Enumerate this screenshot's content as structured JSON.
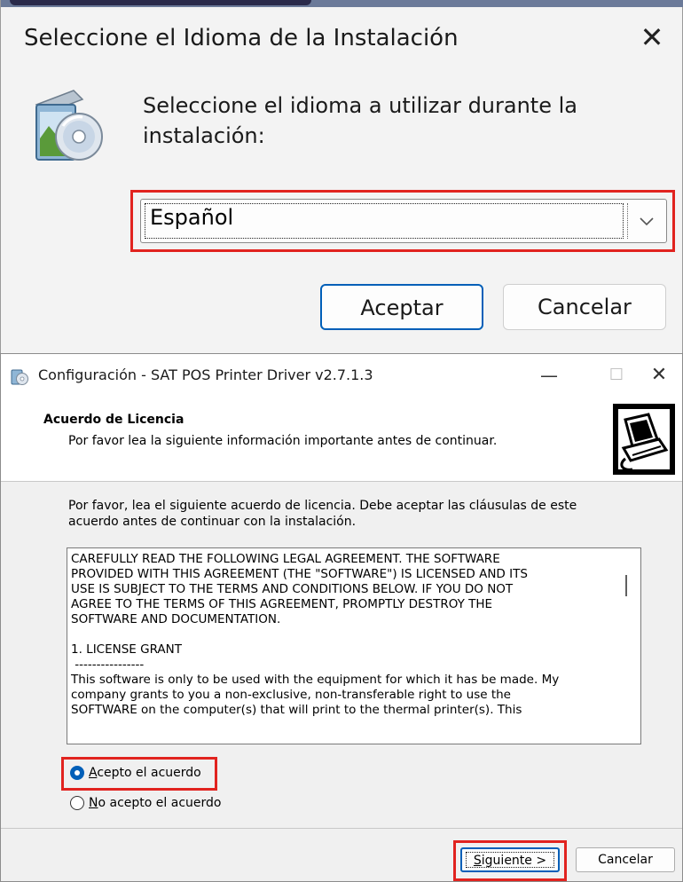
{
  "language_dialog": {
    "title": "Seleccione el Idioma de la Instalación",
    "close_glyph": "✕",
    "prompt": "Seleccione el idioma a utilizar durante la instalación:",
    "language_select": {
      "value": "Español",
      "icon": "chevron-down-icon"
    },
    "buttons": {
      "accept": "Aceptar",
      "cancel": "Cancelar"
    },
    "icon": "setup-cd-icon",
    "highlight_color": "#e1231f",
    "accent_color": "#005fb8"
  },
  "setup_wizard": {
    "window_title": "Configuración - SAT POS Printer Driver v2.7.1.3",
    "caption_buttons": {
      "minimize": "—",
      "maximize": "☐",
      "close": "✕"
    },
    "header": {
      "title": "Acuerdo de Licencia",
      "subtitle": "Por favor lea la siguiente información importante antes de continuar.",
      "icon": "computer-icon"
    },
    "intro": "Por favor, lea el siguiente acuerdo de licencia. Debe aceptar las cláusulas de este acuerdo antes de continuar con la instalación.",
    "license_text": "CAREFULLY READ THE FOLLOWING LEGAL AGREEMENT. THE SOFTWARE\nPROVIDED WITH THIS AGREEMENT (THE \"SOFTWARE\") IS LICENSED AND ITS\nUSE IS SUBJECT TO THE TERMS AND CONDITIONS BELOW. IF YOU DO NOT\nAGREE TO THE TERMS OF THIS AGREEMENT, PROMPTLY DESTROY THE\nSOFTWARE AND DOCUMENTATION.\n\n1. LICENSE GRANT\n ----------------\nThis software is only to be used with the equipment for which it has be made. My\ncompany grants to you a non-exclusive, non-transferable right to use the\nSOFTWARE on the computer(s) that will print to the thermal printer(s). This",
    "radio_accept": {
      "mnemonic": "A",
      "rest": "cepto el acuerdo",
      "checked": true
    },
    "radio_reject": {
      "mnemonic": "N",
      "rest": "o acepto el acuerdo",
      "checked": false
    },
    "buttons": {
      "next_mnemonic": "S",
      "next_rest": "iguiente >",
      "cancel": "Cancelar"
    }
  }
}
